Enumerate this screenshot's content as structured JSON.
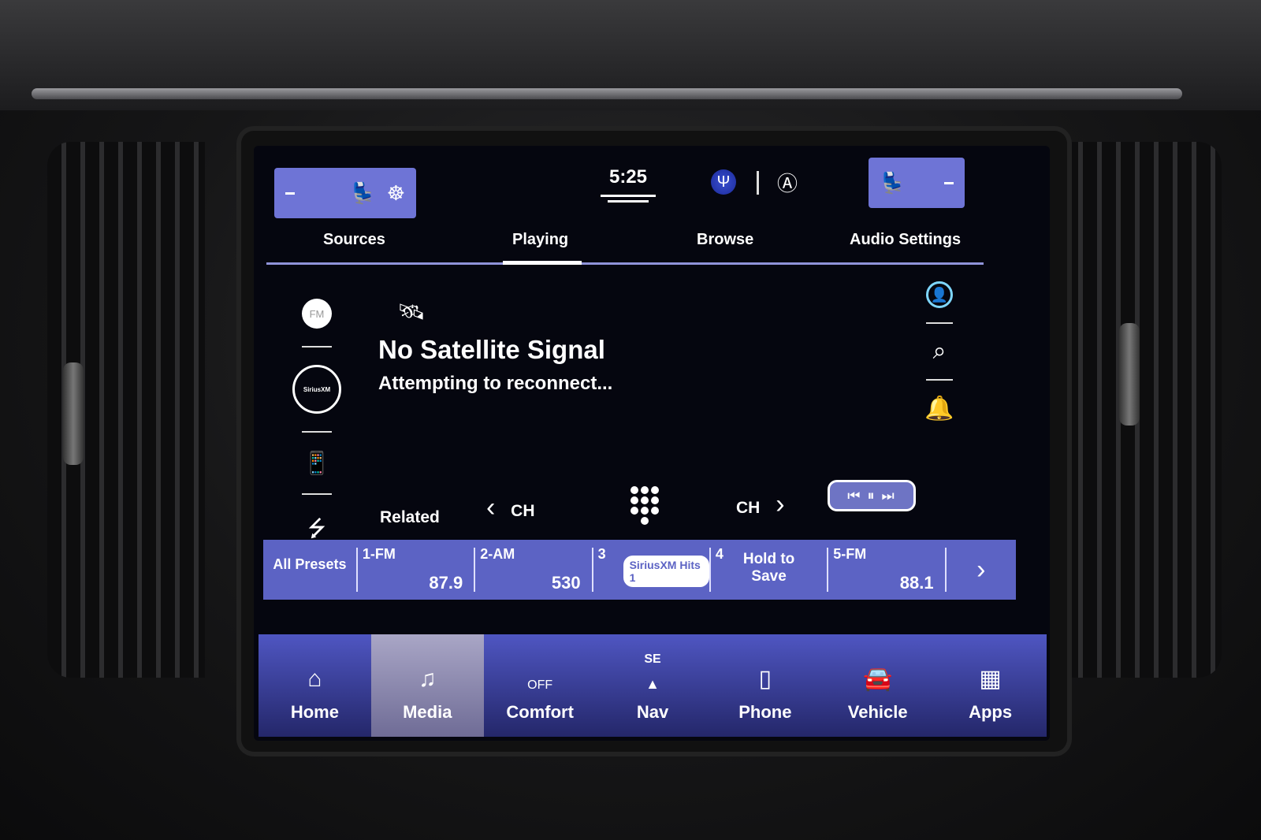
{
  "status_bar": {
    "clock": "5:25",
    "left_climate": {
      "label": "–",
      "icons": [
        "heated-seat-icon",
        "heated-steering-wheel-icon"
      ]
    },
    "right_climate": {
      "label": "–",
      "icons": [
        "heated-seat-icon"
      ]
    },
    "brand_icon": "trident-logo-icon",
    "assist_icon": "driver-assist-icon"
  },
  "tabs": [
    {
      "label": "Sources",
      "active": false
    },
    {
      "label": "Playing",
      "active": true
    },
    {
      "label": "Browse",
      "active": false
    },
    {
      "label": "Audio Settings",
      "active": false
    }
  ],
  "sources": [
    {
      "name": "fm",
      "label": "FM"
    },
    {
      "name": "siriusxm",
      "label": "SiriusXM",
      "active": true
    },
    {
      "name": "bluetooth-audio",
      "icon": "phone-music-icon"
    },
    {
      "name": "usb",
      "icon": "usb-icon"
    }
  ],
  "now_playing": {
    "status_icon": "no-satellite-icon",
    "title": "No Satellite Signal",
    "subtitle": "Attempting to reconnect..."
  },
  "right_rail": [
    "profile-icon",
    "search-icon",
    "notification-bell-icon"
  ],
  "controls": {
    "related": "Related",
    "ch_prev": "CH",
    "ch_next": "CH",
    "prev_glyph": "‹",
    "next_glyph": "›",
    "transport": "⏮ ⏸ ⏭"
  },
  "presets": {
    "all_label": "All Presets",
    "items": [
      {
        "num": "1-FM",
        "value": "87.9"
      },
      {
        "num": "2-AM",
        "value": "530"
      },
      {
        "num": "3",
        "logo": "SiriusXM Hits 1"
      },
      {
        "num": "4",
        "center": "Hold to Save"
      },
      {
        "num": "5-FM",
        "value": "88.1"
      }
    ],
    "more_glyph": "›"
  },
  "nav": [
    {
      "label": "Home",
      "icon": "⌂"
    },
    {
      "label": "Media",
      "icon": "♫",
      "active": true
    },
    {
      "label": "Comfort",
      "icon": "OFF",
      "sub": ""
    },
    {
      "label": "Nav",
      "icon": "▲",
      "sub": "SE"
    },
    {
      "label": "Phone",
      "icon": "▯"
    },
    {
      "label": "Vehicle",
      "icon": "🚘"
    },
    {
      "label": "Apps",
      "icon": "▦"
    }
  ]
}
